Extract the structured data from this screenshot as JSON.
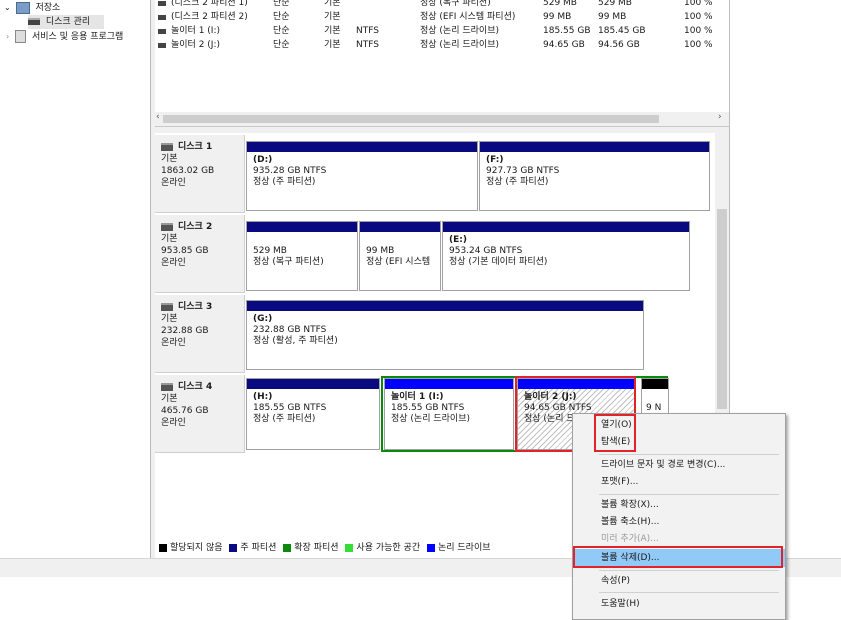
{
  "tree": {
    "storage": "저장소",
    "disk_mgmt": "디스크 관리",
    "services": "서비스 및 응용 프로그램"
  },
  "volume_list": [
    {
      "name": "(디스크 2 파티션 1)",
      "layout": "단순",
      "type": "기본",
      "fs": "",
      "status": "정상 (복구 파티션)",
      "capacity": "529 MB",
      "free": "529 MB",
      "pct": "100 %"
    },
    {
      "name": "(디스크 2 파티션 2)",
      "layout": "단순",
      "type": "기본",
      "fs": "",
      "status": "정상 (EFI 시스템 파티션)",
      "capacity": "99 MB",
      "free": "99 MB",
      "pct": "100 %"
    },
    {
      "name": "놀이터 1 (I:)",
      "layout": "단순",
      "type": "기본",
      "fs": "NTFS",
      "status": "정상 (논리 드라이브)",
      "capacity": "185.55 GB",
      "free": "185.45 GB",
      "pct": "100 %"
    },
    {
      "name": "놀이터 2 (J:)",
      "layout": "단순",
      "type": "기본",
      "fs": "NTFS",
      "status": "정상 (논리 드라이브)",
      "capacity": "94.65 GB",
      "free": "94.56 GB",
      "pct": "100 %"
    }
  ],
  "disks": [
    {
      "title": "디스크 1",
      "kind": "기본",
      "size": "1863.02 GB",
      "state": "온라인",
      "parts": [
        {
          "label": "(D:)",
          "size": "935.28 GB NTFS",
          "status": "정상 (주 파티션)"
        },
        {
          "label": "(F:)",
          "size": "927.73 GB NTFS",
          "status": "정상 (주 파티션)"
        }
      ]
    },
    {
      "title": "디스크 2",
      "kind": "기본",
      "size": "953.85 GB",
      "state": "온라인",
      "parts": [
        {
          "label": "",
          "size": "529 MB",
          "status": "정상 (복구 파티션)"
        },
        {
          "label": "",
          "size": "99 MB",
          "status": "정상 (EFI 시스템"
        },
        {
          "label": "(E:)",
          "size": "953.24 GB NTFS",
          "status": "정상 (기본 데이터 파티션)"
        }
      ]
    },
    {
      "title": "디스크 3",
      "kind": "기본",
      "size": "232.88 GB",
      "state": "온라인",
      "parts": [
        {
          "label": "(G:)",
          "size": "232.88 GB NTFS",
          "status": "정상 (활성, 주 파티션)"
        }
      ]
    },
    {
      "title": "디스크 4",
      "kind": "기본",
      "size": "465.76 GB",
      "state": "온라인",
      "parts": [
        {
          "label": "(H:)",
          "size": "185.55 GB NTFS",
          "status": "정상 (주 파티션)"
        },
        {
          "label": "놀이터 1  (I:)",
          "size": "185.55 GB NTFS",
          "status": "정상 (논리 드라이브)"
        },
        {
          "label": "놀이터 2  (J:)",
          "size": "94.65 GB NTFS",
          "status": "정상 (논리 드라"
        },
        {
          "label": "",
          "size": "9 N",
          "status": ""
        }
      ]
    }
  ],
  "legend": {
    "unallocated": "할당되지 않음",
    "primary": "주 파티션",
    "extended": "확장 파티션",
    "free": "사용 가능한 공간",
    "logical": "논리 드라이브"
  },
  "context_menu": {
    "open": "열기(O)",
    "explore": "탐색(E)",
    "change_letter": "드라이브 문자 및 경로 변경(C)...",
    "format": "포맷(F)...",
    "extend": "볼륨 확장(X)...",
    "shrink": "볼륨 축소(H)...",
    "mirror": "미러 추가(A)...",
    "delete": "볼륨 삭제(D)...",
    "properties": "속성(P)",
    "help": "도움말(H)"
  },
  "colors": {
    "primary": "#0a0a80",
    "logical": "#0000ff",
    "extended": "#0a8a0a",
    "free": "#33dd33",
    "unallocated": "#000000",
    "highlight": "#91c9f7",
    "annotation": "#e0242a"
  }
}
